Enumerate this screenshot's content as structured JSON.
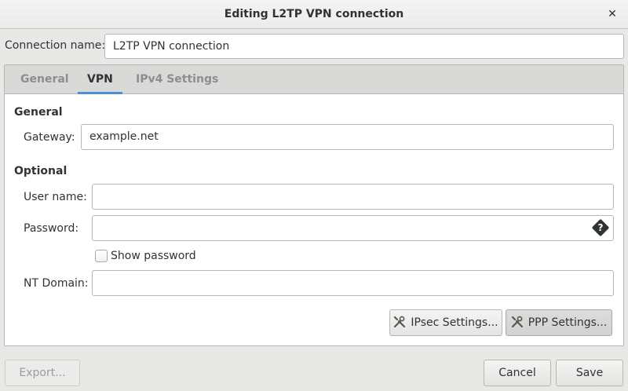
{
  "window": {
    "title": "Editing L2TP VPN connection"
  },
  "connection_name": {
    "label": "Connection name:",
    "value": "L2TP VPN connection"
  },
  "tabs": [
    {
      "label": "General",
      "active": false
    },
    {
      "label": "VPN",
      "active": true
    },
    {
      "label": "IPv4 Settings",
      "active": false
    }
  ],
  "general_section": {
    "title": "General",
    "gateway_label": "Gateway:",
    "gateway_value": "example.net"
  },
  "optional_section": {
    "title": "Optional",
    "username_label": "User name:",
    "username_value": "",
    "password_label": "Password:",
    "password_value": "",
    "show_password_label": "Show password",
    "show_password_checked": false,
    "nt_domain_label": "NT Domain:",
    "nt_domain_value": ""
  },
  "buttons": {
    "ipsec": "IPsec Settings...",
    "ppp": "PPP Settings...",
    "export": "Export...",
    "cancel": "Cancel",
    "save": "Save"
  },
  "icons": {
    "close": "close-icon",
    "password_options": "password-options-icon",
    "ipsec_tools": "tools-icon",
    "ppp_tools": "tools-icon"
  },
  "colors": {
    "accent": "#4a90d9",
    "window_bg": "#e8e8e7"
  }
}
